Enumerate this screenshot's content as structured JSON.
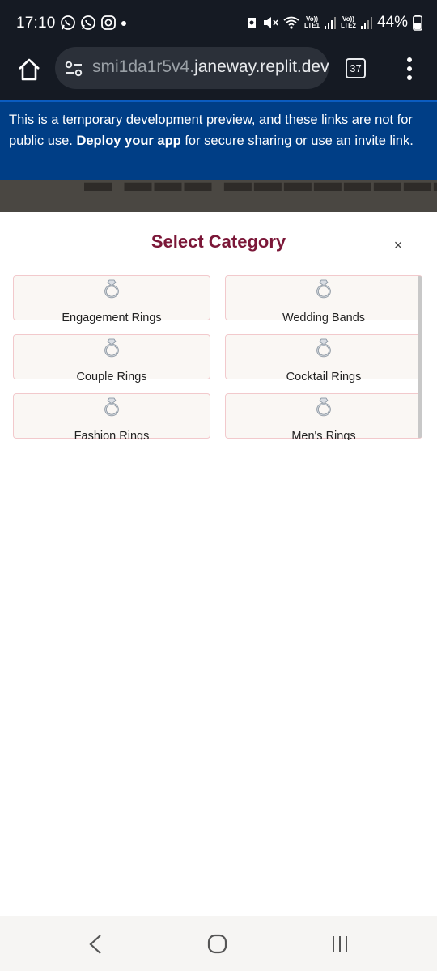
{
  "status_bar": {
    "time": "17:10",
    "app_icons": [
      "whatsapp-icon",
      "whatsapp-business-icon",
      "instagram-icon"
    ],
    "sim1_label_top": "Vo))",
    "sim1_label_bottom": "LTE1",
    "sim2_label_top": "Vo))",
    "sim2_label_bottom": "LTE2",
    "battery": "44%"
  },
  "browser": {
    "url_prefix": "smi1da1r5v4.",
    "url_domain": "janeway.replit.dev",
    "tab_count": "37"
  },
  "banner": {
    "text_before": "This is a temporary development preview, and these links are not for public use. ",
    "link_text": "Deploy your app",
    "text_after": " for secure sharing or use an invite link."
  },
  "modal": {
    "title": "Select Category",
    "close_symbol": "×",
    "categories": [
      {
        "label": "Engagement Rings",
        "icon": "ring-icon"
      },
      {
        "label": "Wedding Bands",
        "icon": "ring-icon"
      },
      {
        "label": "Couple Rings",
        "icon": "ring-icon"
      },
      {
        "label": "Cocktail Rings",
        "icon": "ring-icon"
      },
      {
        "label": "Fashion Rings",
        "icon": "ring-icon"
      },
      {
        "label": "Men's Rings",
        "icon": "ring-icon"
      }
    ]
  },
  "colors": {
    "banner_bg": "#003e86",
    "title_color": "#7b1738",
    "card_border": "#f2c9cc",
    "status_bg": "#151a23"
  }
}
